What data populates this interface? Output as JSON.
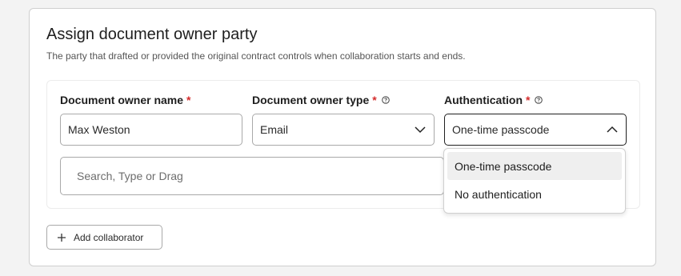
{
  "panel": {
    "title": "Assign document owner party",
    "subtitle": "The party that drafted or provided the original contract controls when collaboration starts and ends."
  },
  "form": {
    "name_label": "Document owner name",
    "name_value": "Max Weston",
    "type_label": "Document owner type",
    "type_value": "Email",
    "auth_label": "Authentication",
    "auth_value": "One-time passcode",
    "required_marker": "*",
    "search_placeholder": "Search, Type or Drag"
  },
  "auth_dropdown": {
    "options": [
      "One-time passcode",
      "No authentication"
    ],
    "selected": "One-time passcode"
  },
  "actions": {
    "add_collaborator_label": "Add collaborator"
  },
  "icons": {
    "help": "question-circle-icon",
    "chevron_down": "chevron-down-icon",
    "chevron_up": "chevron-up-icon",
    "plus": "plus-icon"
  },
  "colors": {
    "required": "#d42b2b",
    "selected_option_bg": "#efefef"
  }
}
